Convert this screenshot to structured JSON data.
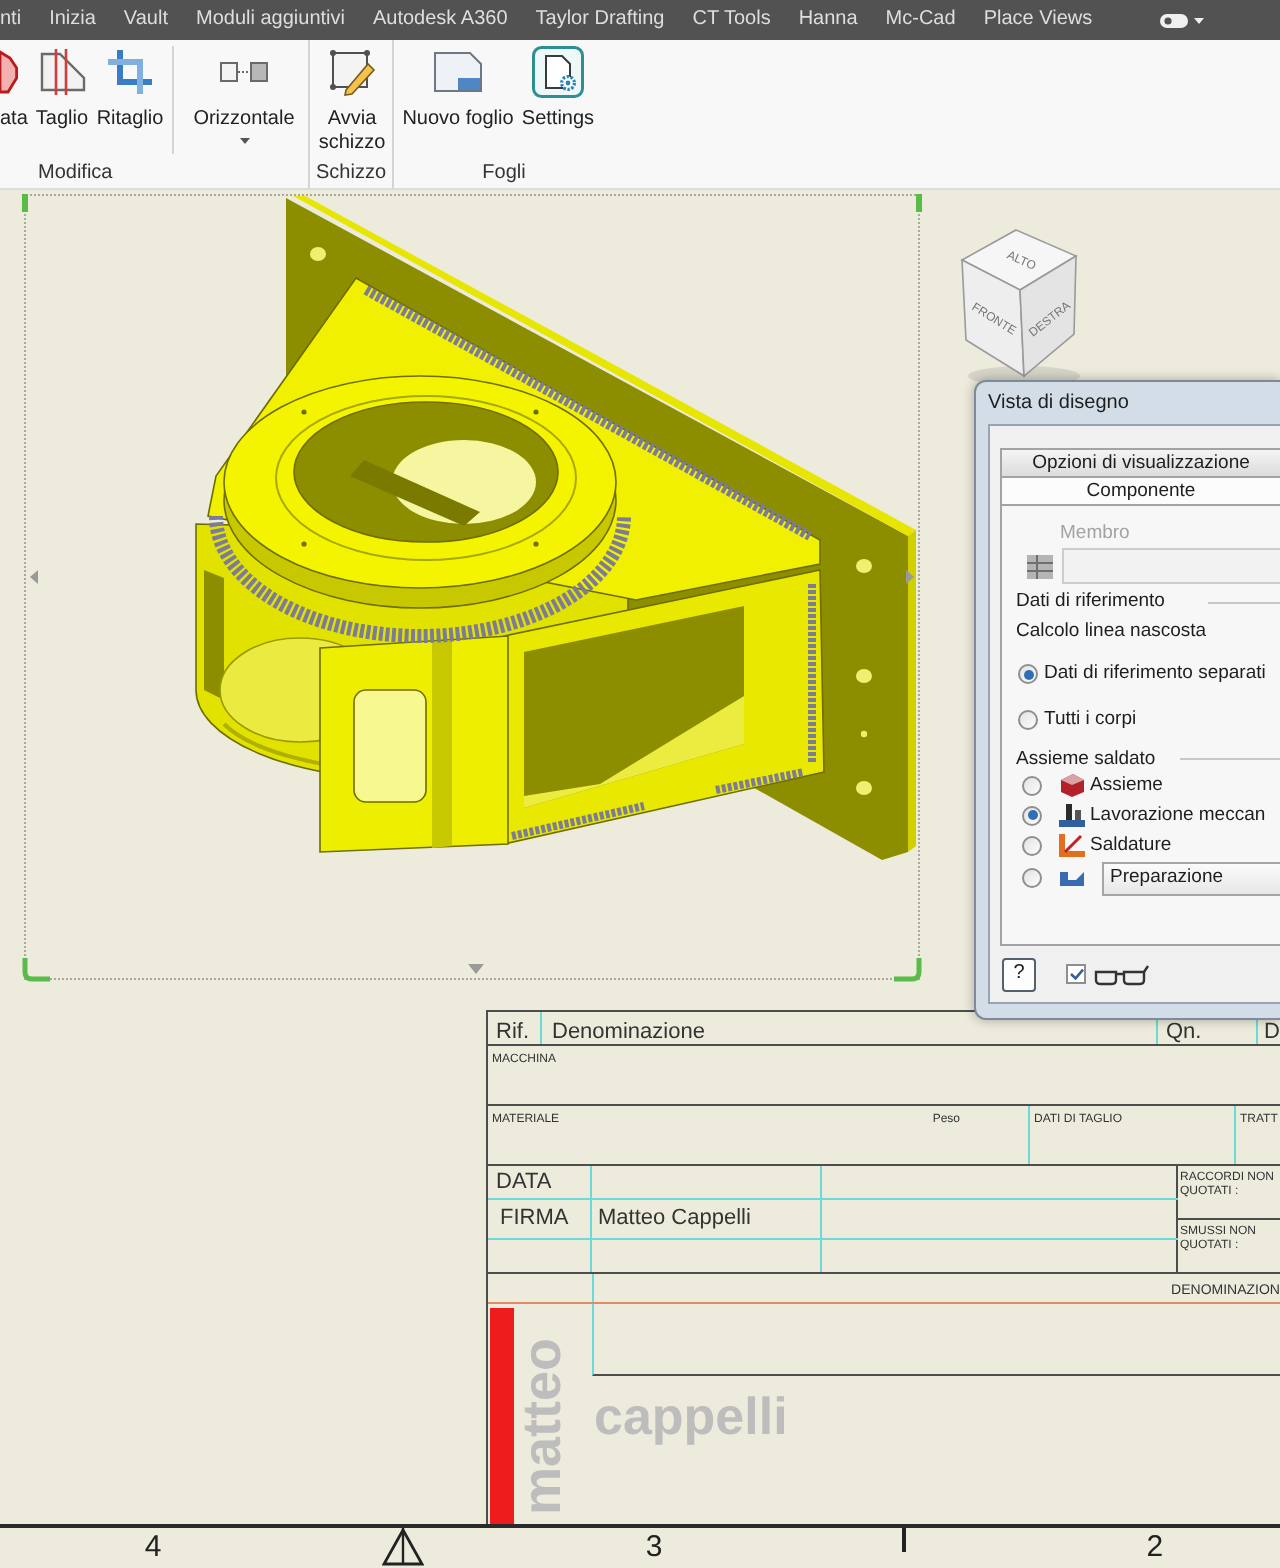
{
  "ribbon_tabs": [
    "nti",
    "Inizia",
    "Vault",
    "Moduli aggiuntivi",
    "Autodesk A360",
    "Taylor Drafting",
    "CT Tools",
    "Hanna",
    "Mc-Cad",
    "Place Views"
  ],
  "ribbon": [
    {
      "label": "Modifica",
      "sections": [
        [
          {
            "label": "ata"
          },
          {
            "label": "Taglio"
          },
          {
            "label": "Ritaglio"
          }
        ],
        [
          {
            "label": "Orizzontale",
            "dropdown": true
          }
        ]
      ]
    },
    {
      "label": "Schizzo",
      "sections": [
        [
          {
            "label": "Avvia schizzo"
          }
        ]
      ]
    },
    {
      "label": "Fogli",
      "sections": [
        [
          {
            "label": "Nuovo foglio"
          },
          {
            "label": "Settings"
          }
        ]
      ]
    }
  ],
  "view_cube": {
    "top": "ALTO",
    "front": "FRONTE",
    "right": "DESTRA"
  },
  "dialog": {
    "title": "Vista di disegno",
    "tabs": [
      {
        "label": "Opzioni di visualizzazione",
        "selected": false
      },
      {
        "label": "Componente",
        "selected": true
      }
    ],
    "member": {
      "label": "Membro",
      "disabled": true
    },
    "reference": {
      "heading": "Dati di riferimento",
      "caption": "Calcolo linea nascosta",
      "options": [
        {
          "label": "Dati di riferimento separati",
          "selected": true
        },
        {
          "label": "Tutti i corpi",
          "selected": false
        }
      ]
    },
    "weldment": {
      "heading": "Assieme saldato",
      "options": [
        {
          "kind": "option",
          "label": "Assieme",
          "selected": false
        },
        {
          "kind": "option",
          "label": "Lavorazione meccan",
          "selected": true
        },
        {
          "kind": "option",
          "label": "Saldature",
          "selected": false
        },
        {
          "kind": "select",
          "value": "Preparazione",
          "selected": false
        }
      ]
    },
    "footer": {
      "help": "?",
      "preview_checked": true
    }
  },
  "title_block": {
    "header": [
      "Rif.",
      "Denominazione",
      "Qn.",
      "D"
    ],
    "machine_label": "MACCHINA",
    "material_row": [
      "MATERIALE",
      "Peso",
      "DATI DI TAGLIO",
      "TRATT"
    ],
    "date_label": "DATA",
    "signature_label": "FIRMA",
    "signature": "Matteo Cappelli",
    "fillets_label": "RACCORDI NON QUOTATI :",
    "chamfers_label": "SMUSSI NON QUOTATI :",
    "name_label": "DENOMINAZION",
    "logo": {
      "first_name": "matteo",
      "last_name": "cappelli"
    }
  },
  "ruler": {
    "labels": [
      "4",
      "3",
      "2"
    ]
  }
}
